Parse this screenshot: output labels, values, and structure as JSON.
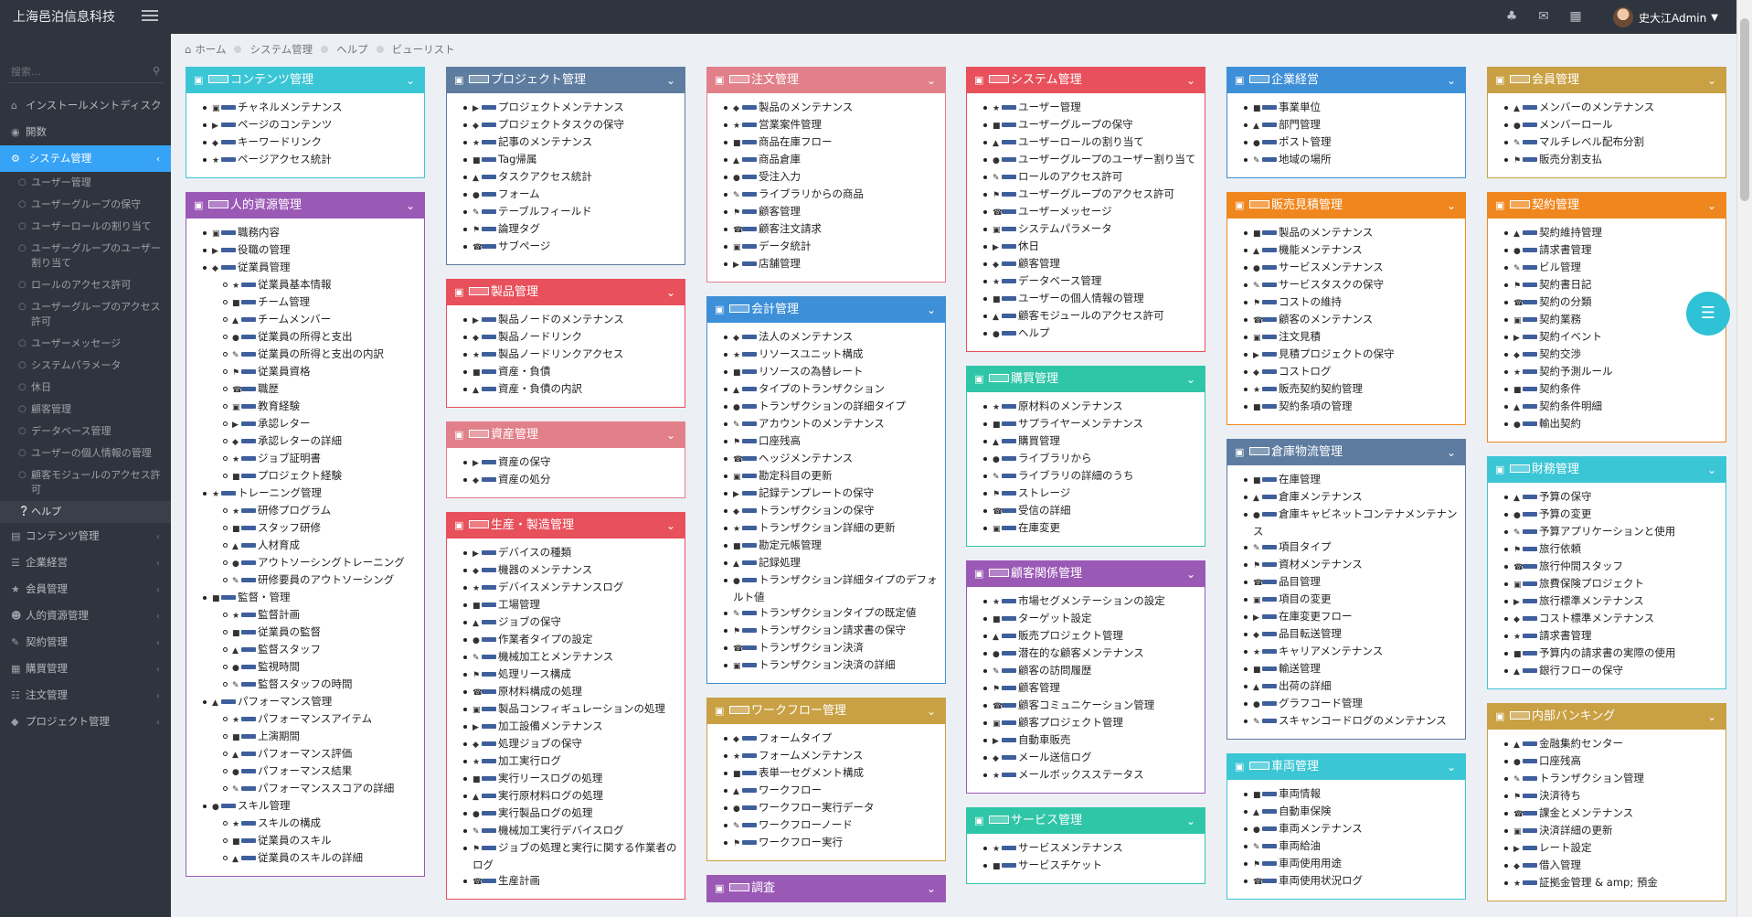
{
  "header": {
    "brand": "上海邑泊信息科技",
    "user_name": "史大江Admin"
  },
  "search": {
    "placeholder": "搜索..."
  },
  "sidebar": {
    "items_top": [
      {
        "label": "インストールメントディスク",
        "icon": "dashboard-icon"
      },
      {
        "label": "開数",
        "icon": "globe-icon"
      }
    ],
    "active": {
      "label": "システム管理",
      "icon": "cogs-icon"
    },
    "sub_items": [
      "ユーザー管理",
      "ユーザーグループの保守",
      "ユーザーロールの割り当て",
      "ユーザーグループのユーザー割り当て",
      "ロールのアクセス許可",
      "ユーザーグループのアクセス許可",
      "ユーザーメッセージ",
      "システムパラメータ",
      "休日",
      "顧客管理",
      "データベース管理",
      "ユーザーの個人情報の管理",
      "顧客モジュールのアクセス許可"
    ],
    "current_sub": "ヘルプ",
    "items_bottom": [
      "コンテンツ管理",
      "企業経営",
      "会員管理",
      "人的資源管理",
      "契約管理",
      "購買管理",
      "注文管理",
      "プロジェクト管理"
    ]
  },
  "breadcrumb": [
    "ホーム",
    "システム管理",
    "ヘルプ",
    "ビューリスト"
  ],
  "fab": {
    "icon": "list-icon"
  },
  "columns": [
    [
      {
        "id": "content",
        "color": "#3bc6d6",
        "icon": "content-icon",
        "title": "コンテンツ管理",
        "items": [
          {
            "t": "チャネルメンテナンス"
          },
          {
            "t": "ページのコンテンツ"
          },
          {
            "t": "キーワードリンク"
          },
          {
            "t": "ページアクセス統計"
          }
        ]
      },
      {
        "id": "hr",
        "color": "#9b59b6",
        "icon": "users-icon",
        "title": "人的資源管理",
        "items": [
          {
            "t": "職務内容"
          },
          {
            "t": "役職の管理"
          },
          {
            "t": "従業員管理",
            "children": [
              "従業員基本情報",
              "チーム管理",
              "チームメンバー",
              "従業員の所得と支出",
              "従業員の所得と支出の内訳",
              "従業員資格",
              "職歴",
              "教育経験",
              "承認レター",
              "承認レターの詳細",
              "ジョブ証明書",
              "プロジェクト経験"
            ]
          },
          {
            "t": "トレーニング管理",
            "children": [
              "研修プログラム",
              "スタッフ研修",
              "人材育成",
              "アウトソーシングトレーニング",
              "研修要員のアウトソーシング"
            ]
          },
          {
            "t": "監督・管理",
            "children": [
              "監督計画",
              "従業員の監督",
              "監督スタッフ",
              "監視時間",
              "監督スタッフの時間"
            ]
          },
          {
            "t": "パフォーマンス管理",
            "children": [
              "パフォーマンスアイテム",
              "上演期間",
              "パフォーマンス評価",
              "パフォーマンス結果",
              "パフォーマンススコアの詳細"
            ]
          },
          {
            "t": "スキル管理",
            "children": [
              "スキルの構成",
              "従業員のスキル",
              "従業員のスキルの詳細"
            ]
          }
        ]
      }
    ],
    [
      {
        "id": "project",
        "color": "#5e7ca0",
        "icon": "project-icon",
        "title": "プロジェクト管理",
        "items": [
          {
            "t": "プロジェクトメンテナンス"
          },
          {
            "t": "プロジェクトタスクの保守"
          },
          {
            "t": "記事のメンテナンス"
          },
          {
            "t": "Tag帰属"
          },
          {
            "t": "タスクアクセス統計"
          },
          {
            "t": "フォーム"
          },
          {
            "t": "テーブルフィールド"
          },
          {
            "t": "論理タグ"
          },
          {
            "t": "サブページ"
          }
        ]
      },
      {
        "id": "product",
        "color": "#e8505b",
        "icon": "edit-icon",
        "title": "製品管理",
        "items": [
          {
            "t": "製品ノードのメンテナンス"
          },
          {
            "t": "製品ノードリンク"
          },
          {
            "t": "製品ノードリンクアクセス"
          },
          {
            "t": "資産・負債"
          },
          {
            "t": "資産・負債の内訳"
          }
        ]
      },
      {
        "id": "asset",
        "color": "#e2808a",
        "icon": "diamond-icon",
        "title": "資産管理",
        "items": [
          {
            "t": "資産の保守"
          },
          {
            "t": "資産の処分"
          }
        ]
      },
      {
        "id": "production",
        "color": "#e8505b",
        "icon": "flow-icon",
        "title": "生産・製造管理",
        "items": [
          {
            "t": "デバイスの種類"
          },
          {
            "t": "機器のメンテナンス"
          },
          {
            "t": "デバイスメンテナンスログ"
          },
          {
            "t": "工場管理"
          },
          {
            "t": "ジョブの保守"
          },
          {
            "t": "作業者タイプの設定"
          },
          {
            "t": "機械加工とメンテナンス"
          },
          {
            "t": "処理リース構成"
          },
          {
            "t": "原材料構成の処理"
          },
          {
            "t": "製品コンフィギュレーションの処理"
          },
          {
            "t": "加工設備メンテナンス"
          },
          {
            "t": "処理ジョブの保守"
          },
          {
            "t": "加工実行ログ"
          },
          {
            "t": "実行リースログの処理"
          },
          {
            "t": "実行原材料ログの処理"
          },
          {
            "t": "実行製品ログの処理"
          },
          {
            "t": "機械加工実行デバイスログ"
          },
          {
            "t": "ジョブの処理と実行に関する作業者のログ"
          },
          {
            "t": "生産計画"
          }
        ]
      }
    ],
    [
      {
        "id": "order",
        "color": "#e2808a",
        "icon": "cart-icon",
        "title": "注文管理",
        "items": [
          {
            "t": "製品のメンテナンス"
          },
          {
            "t": "営業案件管理"
          },
          {
            "t": "商品在庫フロー"
          },
          {
            "t": "商品倉庫"
          },
          {
            "t": "受注入力"
          },
          {
            "t": "ライブラリからの商品"
          },
          {
            "t": "顧客管理"
          },
          {
            "t": "顧客注文請求"
          },
          {
            "t": "データ統計"
          },
          {
            "t": "店舗管理"
          }
        ]
      },
      {
        "id": "accounting",
        "color": "#3d8fd8",
        "icon": "balance-icon",
        "title": "会計管理",
        "items": [
          {
            "t": "法人のメンテナンス"
          },
          {
            "t": "リソースユニット構成"
          },
          {
            "t": "リソースの為替レート"
          },
          {
            "t": "タイプのトランザクション"
          },
          {
            "t": "トランザクションの詳細タイプ"
          },
          {
            "t": "アカウントのメンテナンス"
          },
          {
            "t": "口座残高"
          },
          {
            "t": "ヘッジメンテナンス"
          },
          {
            "t": "勘定科目の更新"
          },
          {
            "t": "記録テンプレートの保守"
          },
          {
            "t": "トランザクションの保守"
          },
          {
            "t": "トランザクション詳細の更新"
          },
          {
            "t": "勘定元帳管理"
          },
          {
            "t": "記録処理"
          },
          {
            "t": "トランザクション詳細タイプのデフォルト値"
          },
          {
            "t": "トランザクションタイプの既定値"
          },
          {
            "t": "トランザクション請求書の保守"
          },
          {
            "t": "トランザクション決済"
          },
          {
            "t": "トランザクション決済の詳細"
          }
        ]
      },
      {
        "id": "workflow",
        "color": "#c9a043",
        "icon": "shuffle-icon",
        "title": "ワークフロー管理",
        "items": [
          {
            "t": "フォームタイプ"
          },
          {
            "t": "フォームメンテナンス"
          },
          {
            "t": "表単一セグメント構成"
          },
          {
            "t": "ワークフロー"
          },
          {
            "t": "ワークフロー実行データ"
          },
          {
            "t": "ワークフローノード"
          },
          {
            "t": "ワークフロー実行"
          }
        ]
      },
      {
        "id": "survey",
        "color": "#9b59b6",
        "icon": "pie-icon",
        "title": "調査",
        "items": []
      }
    ],
    [
      {
        "id": "system",
        "color": "#e8505b",
        "icon": "cogs-icon",
        "title": "システム管理",
        "items": [
          {
            "t": "ユーザー管理"
          },
          {
            "t": "ユーザーグループの保守"
          },
          {
            "t": "ユーザーロールの割り当て"
          },
          {
            "t": "ユーザーグループのユーザー割り当て"
          },
          {
            "t": "ロールのアクセス許可"
          },
          {
            "t": "ユーザーグループのアクセス許可"
          },
          {
            "t": "ユーザーメッセージ"
          },
          {
            "t": "システムパラメータ"
          },
          {
            "t": "休日"
          },
          {
            "t": "顧客管理"
          },
          {
            "t": "データベース管理"
          },
          {
            "t": "ユーザーの個人情報の管理"
          },
          {
            "t": "顧客モジュールのアクセス許可"
          },
          {
            "t": "ヘルプ"
          }
        ]
      },
      {
        "id": "purchase",
        "color": "#2fc6a8",
        "icon": "table-icon",
        "title": "購買管理",
        "items": [
          {
            "t": "原材料のメンテナンス"
          },
          {
            "t": "サプライヤーメンテナンス"
          },
          {
            "t": "購買管理"
          },
          {
            "t": "ライブラリから"
          },
          {
            "t": "ライブラリの詳細のうち"
          },
          {
            "t": "ストレージ"
          },
          {
            "t": "受信の詳細"
          },
          {
            "t": "在庫変更"
          }
        ]
      },
      {
        "id": "crm",
        "color": "#9b59b6",
        "icon": "cogs-icon",
        "title": "顧客関係管理",
        "items": [
          {
            "t": "市場セグメンテーションの設定"
          },
          {
            "t": "ターゲット設定"
          },
          {
            "t": "販売プロジェクト管理"
          },
          {
            "t": "潜在的な顧客メンテナンス"
          },
          {
            "t": "顧客の訪問履歴"
          },
          {
            "t": "顧客管理"
          },
          {
            "t": "顧客コミュニケーション管理"
          },
          {
            "t": "顧客プロジェクト管理"
          },
          {
            "t": "自動車販売"
          },
          {
            "t": "メール送信ログ"
          },
          {
            "t": "メールボックスステータス"
          }
        ]
      },
      {
        "id": "service",
        "color": "#2fc6a8",
        "icon": "card-icon",
        "title": "サービス管理",
        "items": [
          {
            "t": "サービスメンテナンス"
          },
          {
            "t": "サービスチケット"
          }
        ]
      }
    ],
    [
      {
        "id": "enterprise",
        "color": "#3d8fd8",
        "icon": "sitemap-icon",
        "title": "企業経営",
        "items": [
          {
            "t": "事業単位"
          },
          {
            "t": "部門管理"
          },
          {
            "t": "ポスト管理"
          },
          {
            "t": "地域の場所"
          }
        ]
      },
      {
        "id": "sales",
        "color": "#f0871e",
        "icon": "chart-icon",
        "title": "販売見積管理",
        "items": [
          {
            "t": "製品のメンテナンス"
          },
          {
            "t": "機能メンテナンス"
          },
          {
            "t": "サービスメンテナンス"
          },
          {
            "t": "サービスタスクの保守"
          },
          {
            "t": "コストの維持"
          },
          {
            "t": "顧客のメンテナンス"
          },
          {
            "t": "注文見積"
          },
          {
            "t": "見積プロジェクトの保守"
          },
          {
            "t": "コストログ"
          },
          {
            "t": "販売契約契約管理"
          },
          {
            "t": "契約条項の管理"
          }
        ]
      },
      {
        "id": "warehouse",
        "color": "#5e7ca0",
        "icon": "truck-icon",
        "title": "倉庫物流管理",
        "items": [
          {
            "t": "在庫管理"
          },
          {
            "t": "倉庫メンテナンス"
          },
          {
            "t": "倉庫キャビネットコンテナメンテナンス"
          },
          {
            "t": "項目タイプ"
          },
          {
            "t": "資材メンテナンス"
          },
          {
            "t": "品目管理"
          },
          {
            "t": "項目の変更"
          },
          {
            "t": "在庫変更フロー"
          },
          {
            "t": "品目転送管理"
          },
          {
            "t": "キャリアメンテナンス"
          },
          {
            "t": "輸送管理"
          },
          {
            "t": "出荷の詳細"
          },
          {
            "t": "グラフコード管理"
          },
          {
            "t": "スキャンコードログのメンテナンス"
          }
        ]
      },
      {
        "id": "vehicle",
        "color": "#3bc6d6",
        "icon": "edit-icon",
        "title": "車両管理",
        "items": [
          {
            "t": "車両情報"
          },
          {
            "t": "自動車保険"
          },
          {
            "t": "車両メンテナンス"
          },
          {
            "t": "車両給油"
          },
          {
            "t": "車両使用用途"
          },
          {
            "t": "車両使用状況ログ"
          }
        ]
      }
    ],
    [
      {
        "id": "member",
        "color": "#c9a043",
        "icon": "trophy-icon",
        "title": "会員管理",
        "items": [
          {
            "t": "メンバーのメンテナンス"
          },
          {
            "t": "メンバーロール"
          },
          {
            "t": "マルチレベル配布分割"
          },
          {
            "t": "販売分割支払"
          }
        ]
      },
      {
        "id": "contract",
        "color": "#f0871e",
        "icon": "edit-icon",
        "title": "契約管理",
        "items": [
          {
            "t": "契約維持管理"
          },
          {
            "t": "請求書管理"
          },
          {
            "t": "ビル管理"
          },
          {
            "t": "契約書日記"
          },
          {
            "t": "契約の分類"
          },
          {
            "t": "契約業務"
          },
          {
            "t": "契約イベント"
          },
          {
            "t": "契約交渉"
          },
          {
            "t": "契約予測ルール"
          },
          {
            "t": "契約条件"
          },
          {
            "t": "契約条件明細"
          },
          {
            "t": "輸出契約"
          }
        ]
      },
      {
        "id": "finance",
        "color": "#3bc6d6",
        "icon": "money-icon",
        "title": "財務管理",
        "items": [
          {
            "t": "予算の保守"
          },
          {
            "t": "予算の変更"
          },
          {
            "t": "予算アプリケーションと使用"
          },
          {
            "t": "旅行依頼"
          },
          {
            "t": "旅行仲間スタッフ"
          },
          {
            "t": "旅費保険プロジェクト"
          },
          {
            "t": "旅行標準メンテナンス"
          },
          {
            "t": "コスト標準メンテナンス"
          },
          {
            "t": "請求書管理"
          },
          {
            "t": "予算内の請求書の実際の使用"
          },
          {
            "t": "銀行フローの保守"
          }
        ]
      },
      {
        "id": "banking",
        "color": "#c9a043",
        "icon": "bank-icon",
        "title": "内部バンキング",
        "items": [
          {
            "t": "金融集約センター"
          },
          {
            "t": "口座残高"
          },
          {
            "t": "トランザクション管理"
          },
          {
            "t": "決済待ち"
          },
          {
            "t": "課金とメンテナンス"
          },
          {
            "t": "決済詳細の更新"
          },
          {
            "t": "レート設定"
          },
          {
            "t": "借入管理"
          },
          {
            "t": "証拠金管理 & amp; 預金"
          }
        ]
      }
    ]
  ]
}
